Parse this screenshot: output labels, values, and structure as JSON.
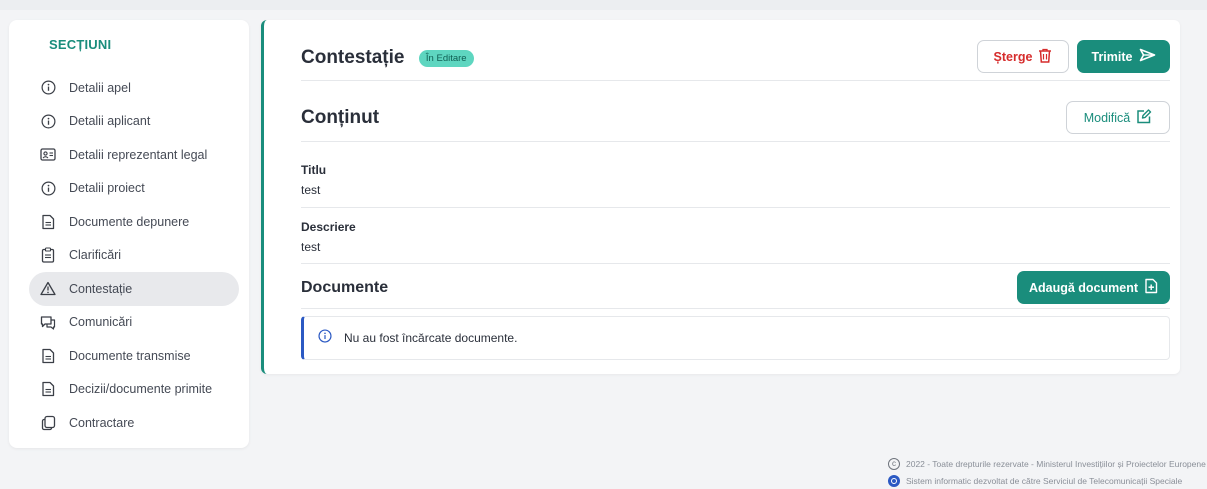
{
  "sidebar": {
    "title": "SECȚIUNI",
    "items": [
      {
        "label": "Detalii apel",
        "icon": "info-circle-icon"
      },
      {
        "label": "Detalii aplicant",
        "icon": "info-circle-icon"
      },
      {
        "label": "Detalii reprezentant legal",
        "icon": "id-card-icon"
      },
      {
        "label": "Detalii proiect",
        "icon": "info-circle-icon"
      },
      {
        "label": "Documente depunere",
        "icon": "document-icon"
      },
      {
        "label": "Clarificări",
        "icon": "clipboard-icon"
      },
      {
        "label": "Contestație",
        "icon": "warning-triangle-icon",
        "active": true
      },
      {
        "label": "Comunicări",
        "icon": "chat-icon"
      },
      {
        "label": "Documente transmise",
        "icon": "document-icon"
      },
      {
        "label": "Decizii/documente primite",
        "icon": "document-icon"
      },
      {
        "label": "Contractare",
        "icon": "copy-icon"
      }
    ]
  },
  "main": {
    "title": "Contestație",
    "status_badge": "În Editare",
    "delete_label": "Șterge",
    "send_label": "Trimite",
    "content_title": "Conținut",
    "modify_label": "Modifică",
    "fields": [
      {
        "label": "Titlu",
        "value": "test"
      },
      {
        "label": "Descriere",
        "value": "test"
      }
    ],
    "documents_title": "Documente",
    "add_document_label": "Adaugă document",
    "empty_message": "Nu au fost încărcate documente."
  },
  "footer": {
    "copyright": "2022 - Toate drepturile rezervate - Ministerul Investițiilor și Proiectelor Europene",
    "developer": "Sistem informatic dezvoltat de către Serviciul de Telecomunicații Speciale"
  },
  "colors": {
    "accent": "#1a8d7c",
    "danger": "#d62c2c",
    "info": "#2b59c3",
    "badge": "#5ed6c0"
  }
}
